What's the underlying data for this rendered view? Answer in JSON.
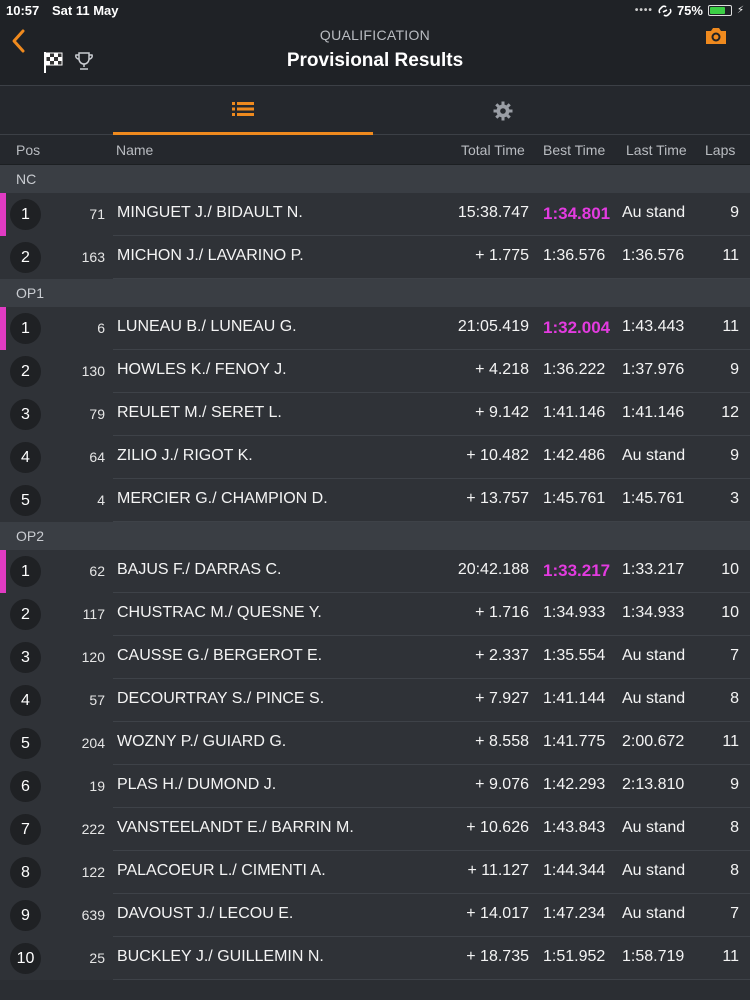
{
  "status": {
    "time": "10:57",
    "date": "Sat 11 May",
    "battery": "75%",
    "battery_level": 0.75
  },
  "header": {
    "subtitle": "QUALIFICATION",
    "title": "Provisional Results"
  },
  "columns": {
    "pos": "Pos",
    "name": "Name",
    "total": "Total Time",
    "best": "Best Time",
    "last": "Last Time",
    "laps": "Laps"
  },
  "colors": {
    "accent": "#ef8a1e",
    "fastest": "#e33be0"
  },
  "groups": [
    {
      "name": "NC",
      "rows": [
        {
          "pos": "1",
          "num": "71",
          "name": "MINGUET J./ BIDAULT N.",
          "total": "15:38.747",
          "best": "1:34.801",
          "last": "Au stand",
          "laps": "9",
          "fastest": true
        },
        {
          "pos": "2",
          "num": "163",
          "name": "MICHON J./ LAVARINO P.",
          "total": "+ 1.775",
          "best": "1:36.576",
          "last": "1:36.576",
          "laps": "11",
          "fastest": false
        }
      ]
    },
    {
      "name": "OP1",
      "rows": [
        {
          "pos": "1",
          "num": "6",
          "name": "LUNEAU B./ LUNEAU G.",
          "total": "21:05.419",
          "best": "1:32.004",
          "last": "1:43.443",
          "laps": "11",
          "fastest": true
        },
        {
          "pos": "2",
          "num": "130",
          "name": "HOWLES K./ FENOY J.",
          "total": "+ 4.218",
          "best": "1:36.222",
          "last": "1:37.976",
          "laps": "9",
          "fastest": false
        },
        {
          "pos": "3",
          "num": "79",
          "name": "REULET M./ SERET L.",
          "total": "+ 9.142",
          "best": "1:41.146",
          "last": "1:41.146",
          "laps": "12",
          "fastest": false
        },
        {
          "pos": "4",
          "num": "64",
          "name": "ZILIO J./ RIGOT K.",
          "total": "+ 10.482",
          "best": "1:42.486",
          "last": "Au stand",
          "laps": "9",
          "fastest": false
        },
        {
          "pos": "5",
          "num": "4",
          "name": "MERCIER G./ CHAMPION D.",
          "total": "+ 13.757",
          "best": "1:45.761",
          "last": "1:45.761",
          "laps": "3",
          "fastest": false
        }
      ]
    },
    {
      "name": "OP2",
      "rows": [
        {
          "pos": "1",
          "num": "62",
          "name": "BAJUS F./ DARRAS C.",
          "total": "20:42.188",
          "best": "1:33.217",
          "last": "1:33.217",
          "laps": "10",
          "fastest": true
        },
        {
          "pos": "2",
          "num": "117",
          "name": "CHUSTRAC M./ QUESNE Y.",
          "total": "+ 1.716",
          "best": "1:34.933",
          "last": "1:34.933",
          "laps": "10",
          "fastest": false
        },
        {
          "pos": "3",
          "num": "120",
          "name": "CAUSSE G./ BERGEROT E.",
          "total": "+ 2.337",
          "best": "1:35.554",
          "last": "Au stand",
          "laps": "7",
          "fastest": false
        },
        {
          "pos": "4",
          "num": "57",
          "name": "DECOURTRAY S./ PINCE S.",
          "total": "+ 7.927",
          "best": "1:41.144",
          "last": "Au stand",
          "laps": "8",
          "fastest": false
        },
        {
          "pos": "5",
          "num": "204",
          "name": "WOZNY P./ GUIARD G.",
          "total": "+ 8.558",
          "best": "1:41.775",
          "last": "2:00.672",
          "laps": "11",
          "fastest": false
        },
        {
          "pos": "6",
          "num": "19",
          "name": "PLAS H./ DUMOND J.",
          "total": "+ 9.076",
          "best": "1:42.293",
          "last": "2:13.810",
          "laps": "9",
          "fastest": false
        },
        {
          "pos": "7",
          "num": "222",
          "name": "VANSTEELANDT E./ BARRIN M.",
          "total": "+ 10.626",
          "best": "1:43.843",
          "last": "Au stand",
          "laps": "8",
          "fastest": false
        },
        {
          "pos": "8",
          "num": "122",
          "name": "PALACOEUR L./ CIMENTI A.",
          "total": "+ 11.127",
          "best": "1:44.344",
          "last": "Au stand",
          "laps": "8",
          "fastest": false
        },
        {
          "pos": "9",
          "num": "639",
          "name": "DAVOUST J./ LECOU E.",
          "total": "+ 14.017",
          "best": "1:47.234",
          "last": "Au stand",
          "laps": "7",
          "fastest": false
        },
        {
          "pos": "10",
          "num": "25",
          "name": "BUCKLEY J./ GUILLEMIN N.",
          "total": "+ 18.735",
          "best": "1:51.952",
          "last": "1:58.719",
          "laps": "11",
          "fastest": false
        }
      ]
    }
  ]
}
